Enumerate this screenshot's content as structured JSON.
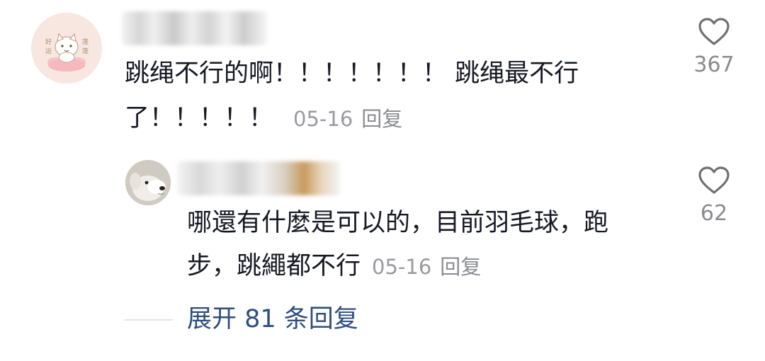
{
  "comment": {
    "avatar_icon": "cat-avatar-icon",
    "avatar_chars": [
      "好",
      "运",
      "莲",
      "莲"
    ],
    "text_line1": "跳绳不行的啊！！！！！！！ 跳绳最不行",
    "text_line2": "了！！！！！",
    "date": "05-16",
    "reply_label": "回复",
    "like_icon": "heart-outline-icon",
    "like_count": "367"
  },
  "reply": {
    "avatar_icon": "dog-avatar-icon",
    "text_line1": "哪還有什麼是可以的，目前羽毛球，跑",
    "text_line2": "步，跳繩都不行",
    "date": "05-16",
    "reply_label": "回复",
    "like_icon": "heart-outline-icon",
    "like_count": "62"
  },
  "expand": {
    "label": "展开 81 条回复"
  },
  "colors": {
    "text_primary": "#161823",
    "text_secondary": "#8a8b91",
    "link": "#2d4e7e",
    "avatar_bg": "#f8e7e1"
  }
}
